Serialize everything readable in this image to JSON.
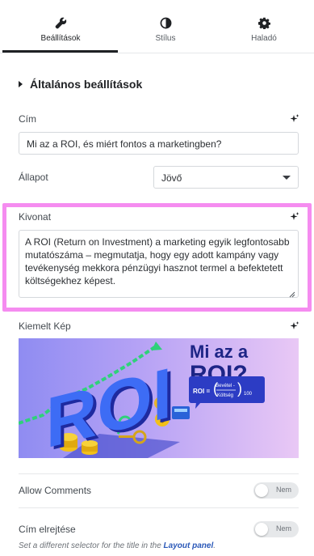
{
  "tabs": [
    {
      "label": "Beállítások",
      "icon": "wrench-icon",
      "active": true
    },
    {
      "label": "Stílus",
      "icon": "half-circle-icon",
      "active": false
    },
    {
      "label": "Haladó",
      "icon": "gear-icon",
      "active": false
    }
  ],
  "section": {
    "title": "Általános beállítások"
  },
  "title_field": {
    "label": "Cím",
    "value": "Mi az a ROI, és miért fontos a marketingben?"
  },
  "status_field": {
    "label": "Állapot",
    "value": "Jövő"
  },
  "excerpt_field": {
    "label": "Kivonat",
    "value": "A ROI (Return on Investment) a marketing egyik legfontosabb mutatószáma – megmutatja, hogy egy adott kampány vagy tevékenység mekkora pénzügyi hasznot termel a befektetett költségekhez képest."
  },
  "featured_image": {
    "label": "Kiemelt Kép",
    "headline_1": "Mi az a",
    "headline_2": "ROI?",
    "big_text": "ROI",
    "formula_prefix": "ROI =",
    "formula_top": "Bevétel -",
    "formula_bottom": "Költség",
    "formula_factor": "100"
  },
  "allow_comments": {
    "label": "Allow Comments",
    "toggle_label": "Nem"
  },
  "hide_title": {
    "label": "Cím elrejtése",
    "toggle_label": "Nem"
  },
  "help_text": {
    "before": "Set a different selector for the title in the ",
    "link": "Layout panel",
    "after": "."
  },
  "colors": {
    "highlight": "#f58cf0",
    "link": "#2a58b8",
    "active_tab": "#1f2124"
  }
}
